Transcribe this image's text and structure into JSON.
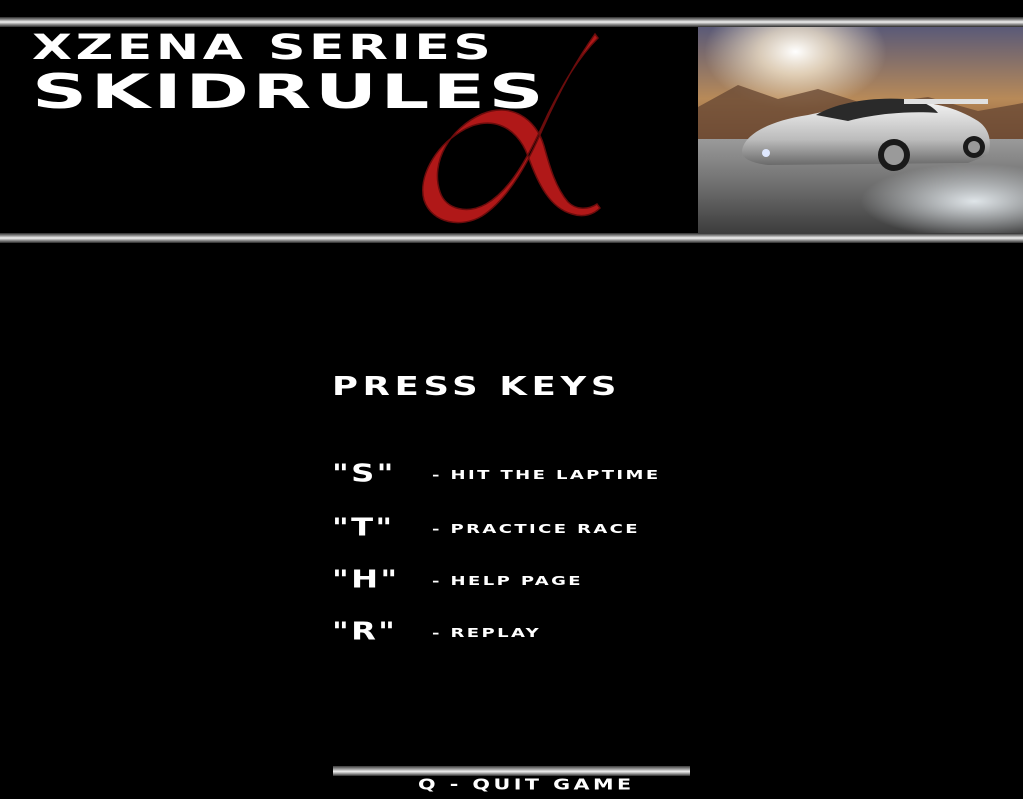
{
  "header": {
    "title_line1": "XZENA SERIES",
    "title_line2": "SKIDRULES",
    "logo_symbol": "α",
    "logo_color": "#b01818"
  },
  "menu": {
    "heading": "PRESS KEYS",
    "items": [
      {
        "key": "\"S\"",
        "action": "- HIT THE LAPTIME"
      },
      {
        "key": "\"T\"",
        "action": "- PRACTICE RACE"
      },
      {
        "key": "\"H\"",
        "action": "- HELP PAGE"
      },
      {
        "key": "\"R\"",
        "action": "- REPLAY"
      }
    ]
  },
  "footer": {
    "quit_label": "Q - QUIT GAME"
  },
  "colors": {
    "background": "#000000",
    "text": "#ffffff",
    "accent": "#b01818"
  }
}
